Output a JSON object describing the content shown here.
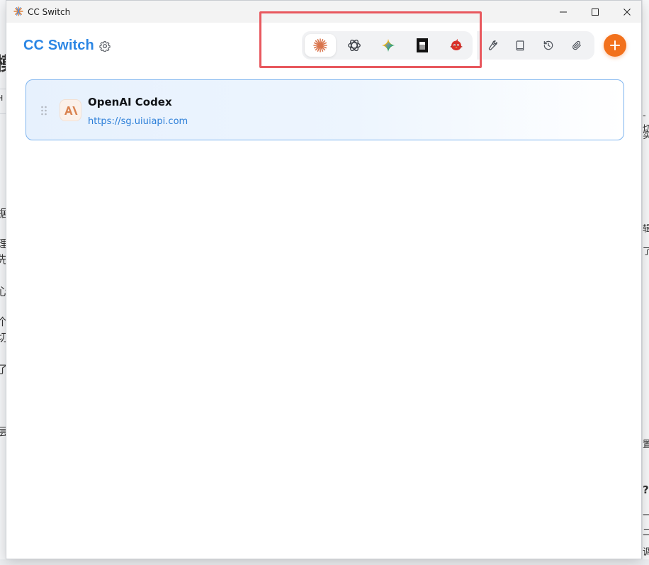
{
  "window": {
    "title": "CC Switch"
  },
  "header": {
    "brand": "CC Switch",
    "apps": [
      {
        "name": "claude",
        "icon": "claude-sparkle-icon",
        "active": true
      },
      {
        "name": "codex",
        "icon": "openai-knot-icon",
        "active": false
      },
      {
        "name": "gemini",
        "icon": "gemini-star-icon",
        "active": false
      },
      {
        "name": "opencode",
        "icon": "opencode-block-icon",
        "active": false
      },
      {
        "name": "app-5",
        "icon": "red-bird-icon",
        "active": false
      }
    ],
    "tools": [
      {
        "icon": "wrench-icon"
      },
      {
        "icon": "book-icon"
      },
      {
        "icon": "history-icon"
      },
      {
        "icon": "paperclip-icon"
      }
    ],
    "add_icon": "plus-icon"
  },
  "providers": [
    {
      "name": "OpenAI Codex",
      "url": "https://sg.uiuiapi.com",
      "logo": "anthropic-logo-icon",
      "selected": true
    }
  ],
  "background_glyphs": {
    "left": [
      "模",
      "H",
      "据",
      "理",
      "先",
      "心",
      "个",
      "切",
      "了",
      "层"
    ],
    "right": [
      "-切",
      "实",
      "辑",
      "了",
      "置",
      "?",
      "一",
      "二",
      "调"
    ]
  },
  "colors": {
    "brand": "#2b86e4",
    "accent_orange": "#f2711c",
    "annotation_red": "#e8585e",
    "link": "#2b7ed8",
    "card_border": "#7fb5ef"
  }
}
